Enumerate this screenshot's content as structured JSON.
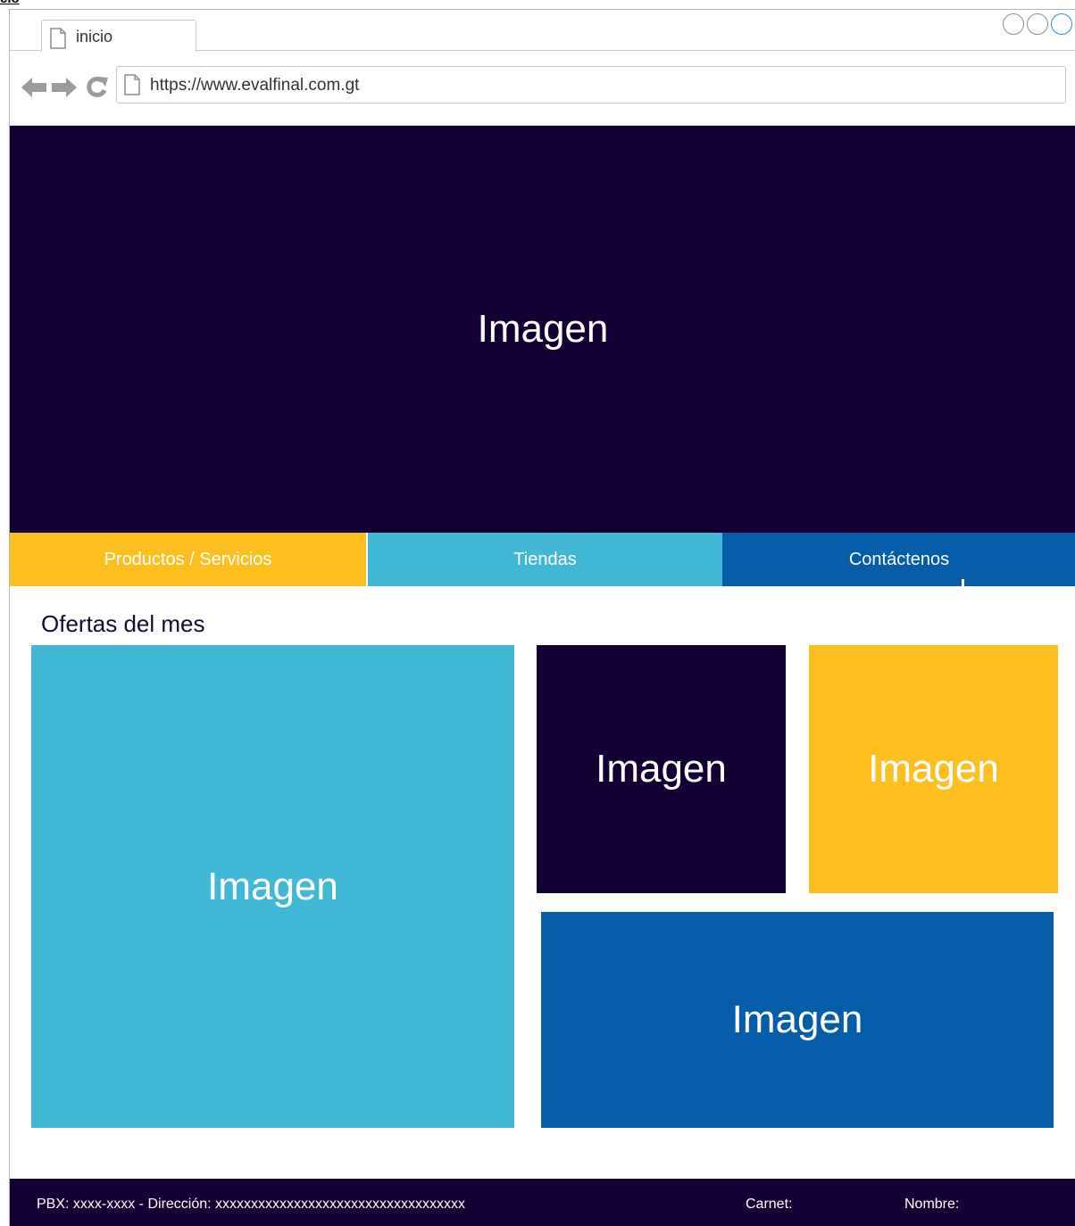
{
  "page_label": "cio",
  "browser": {
    "tab_title": "inicio",
    "url": "https://www.evalfinal.com.gt"
  },
  "hero": {
    "image_label": "Imagen",
    "bg_color": "#120033"
  },
  "menu": {
    "items": [
      {
        "label": "Productos / Servicios",
        "color": "#fdbf20"
      },
      {
        "label": "Tiendas",
        "color": "#41b9d6"
      },
      {
        "label": "Contáctenos",
        "color": "#055ca8"
      }
    ]
  },
  "offers": {
    "title": "Ofertas del mes",
    "items": [
      {
        "label": "Imagen",
        "color": "#41b9d6"
      },
      {
        "label": "Imagen",
        "color": "#120033"
      },
      {
        "label": "Imagen",
        "color": "#fdbf20"
      },
      {
        "label": "Imagen",
        "color": "#055ca8"
      }
    ]
  },
  "footer": {
    "contact": "PBX: xxxx-xxxx  -  Dirección: xxxxxxxxxxxxxxxxxxxxxxxxxxxxxxxxxxx",
    "carnet_label": "Carnet:",
    "nombre_label": "Nombre:"
  },
  "icons": {
    "back": "arrow-left-icon",
    "forward": "arrow-right-icon",
    "reload": "reload-icon",
    "page": "document-icon"
  }
}
